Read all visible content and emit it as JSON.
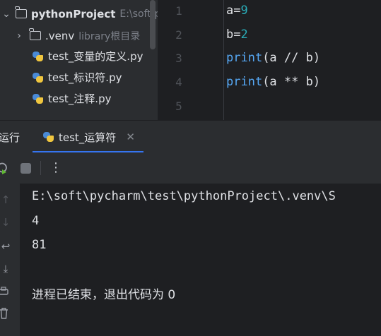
{
  "project_tree": {
    "root": {
      "name": "pythonProject",
      "path": "E:\\soft\\p"
    },
    "venv": {
      "name": ".venv",
      "hint": "library根目录"
    },
    "files": [
      "test_变量的定义.py",
      "test_标识符.py",
      "test_注释.py"
    ]
  },
  "editor": {
    "line_numbers": [
      "1",
      "2",
      "3",
      "4",
      "5"
    ],
    "lines": {
      "l1_var": "a",
      "l1_eq": "=",
      "l1_val": "9",
      "l2_var": "b",
      "l2_eq": "=",
      "l2_val": "2",
      "l3_fn": "print",
      "l3_args": "(a // b)",
      "l4_fn": "print",
      "l4_args": "(a ** b)"
    }
  },
  "run_panel": {
    "title": "运行",
    "tab_label": "test_运算符",
    "toolbar": {
      "rerun_icon": "rerun-icon",
      "stop_icon": "stop-icon",
      "more": "⋮"
    },
    "console": {
      "command": "E:\\soft\\pycharm\\test\\pythonProject\\.venv\\S",
      "output": [
        "4",
        "81"
      ],
      "exit_message": "进程已结束，退出代码为 0"
    }
  },
  "colors": {
    "panel_bg": "#2b2d30",
    "editor_bg": "#1e1f22",
    "number": "#2aacb8",
    "function": "#56a8f5",
    "accent": "#3574f0"
  }
}
